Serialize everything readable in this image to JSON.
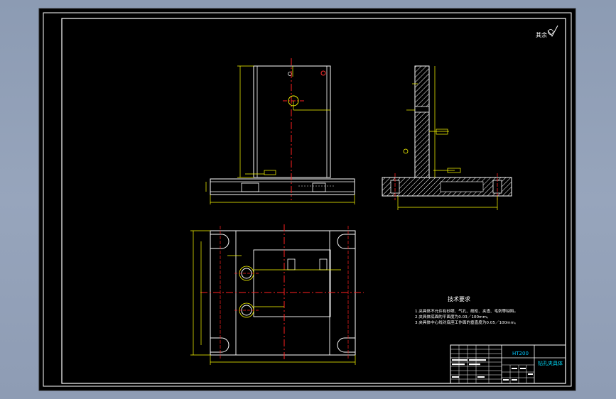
{
  "drawing": {
    "roughness_note": "其余",
    "tech_title": "技术要求",
    "tech_requirements": [
      "1.夹具体不允许有砂眼、气孔、疏松、夹渣、毛刺等缺陷。",
      "2.夹具体底面的平面度为0.03／100mm。",
      "3.夹具体中心线对底座工作面的垂直度为0.05／100mm。"
    ],
    "title_block": {
      "material": "HT200",
      "part_name": "钻孔夹具体"
    }
  },
  "colors": {
    "background": "#000000",
    "outline": "#ffffff",
    "centerline": "#ff2020",
    "dimension": "#ffff00",
    "hatch": "#ffffff",
    "window_frame": "#8c9bb3"
  }
}
